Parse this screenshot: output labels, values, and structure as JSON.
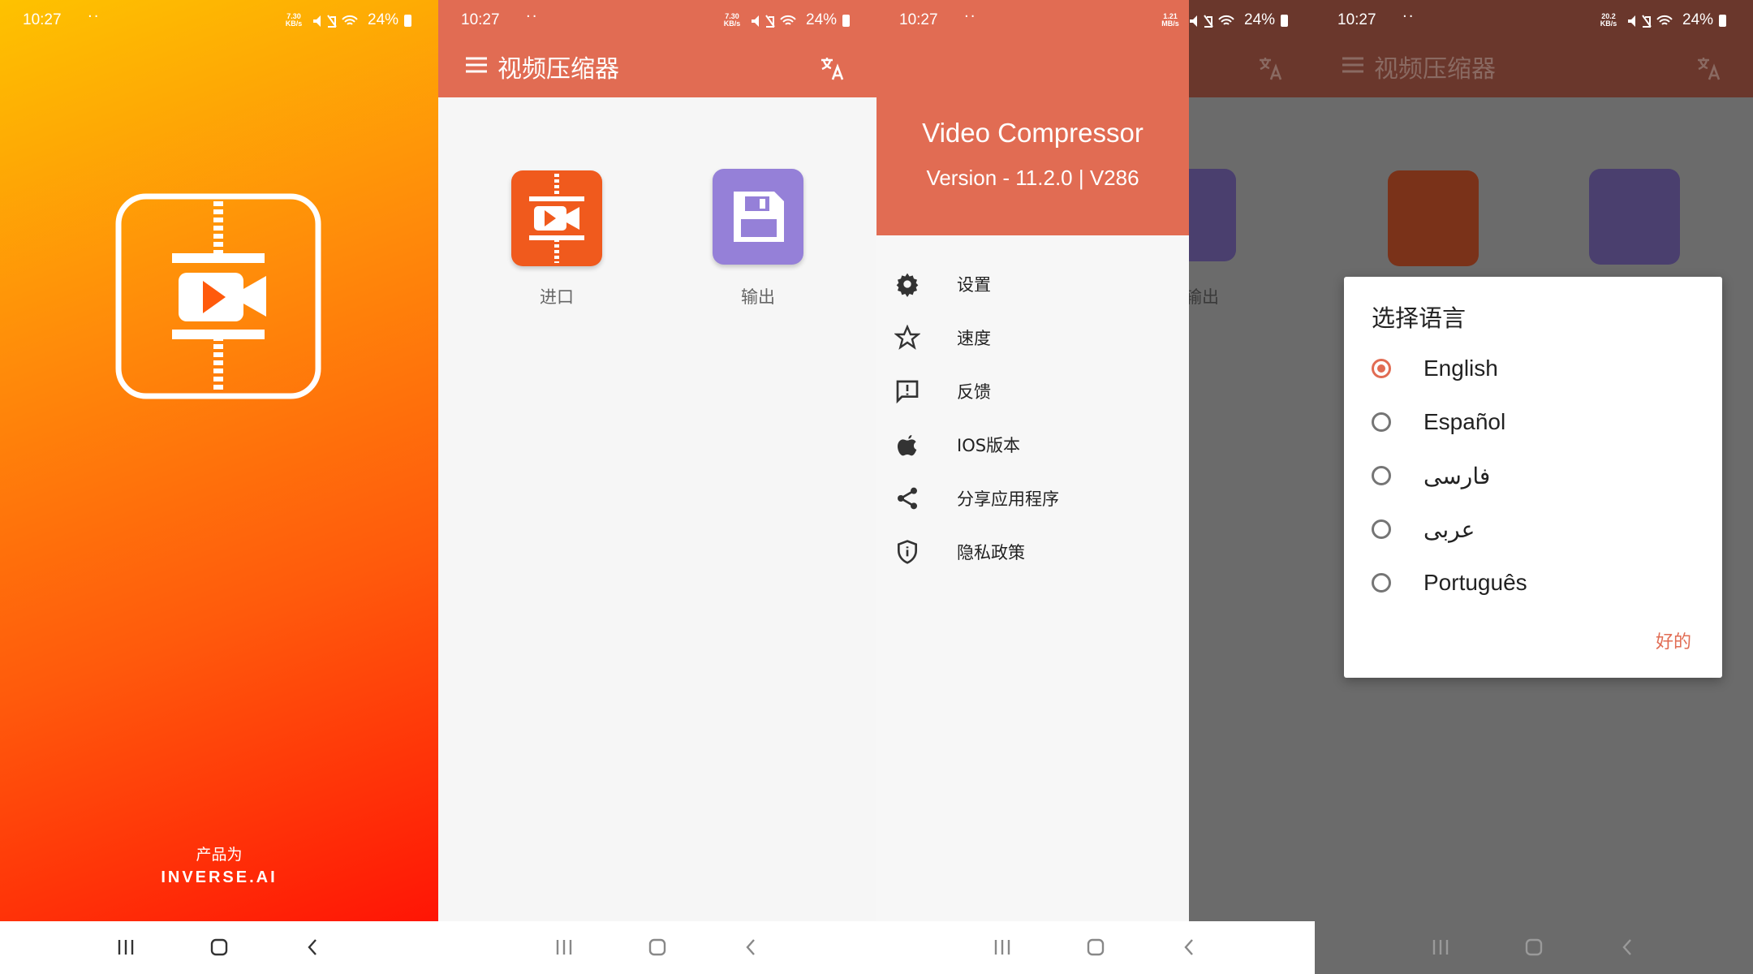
{
  "status_bars": [
    {
      "time": "10:27",
      "net_speed": "7.30\nKB/s",
      "battery": "24%"
    },
    {
      "time": "10:27",
      "net_speed": "7.30\nKB/s",
      "battery": "24%"
    },
    {
      "time": "10:27",
      "net_speed": "1.21\nMB/s",
      "battery": "24%"
    },
    {
      "time": "10:27",
      "net_speed": "20.2\nKB/s",
      "battery": "24%"
    }
  ],
  "splash": {
    "made_by": "产品为",
    "brand": "INVERSE.AI"
  },
  "home": {
    "title": "视频压缩器",
    "import_label": "进口",
    "output_label": "输出"
  },
  "drawer": {
    "app_name": "Video Compressor",
    "version": "Version - 11.2.0 | V286",
    "items": [
      {
        "label": "设置",
        "icon": "gear-icon"
      },
      {
        "label": "速度",
        "icon": "star-icon"
      },
      {
        "label": "反馈",
        "icon": "feedback-icon"
      },
      {
        "label": "IOS版本",
        "icon": "apple-icon"
      },
      {
        "label": "分享应用程序",
        "icon": "share-icon"
      },
      {
        "label": "隐私政策",
        "icon": "shield-icon"
      }
    ],
    "behind_label": "输出"
  },
  "language_dialog": {
    "title": "选择语言",
    "options": [
      "English",
      "Español",
      "فارسی",
      "عربی",
      "Português"
    ],
    "selected": "English",
    "ok": "好的"
  },
  "colors": {
    "accent": "#e16c53",
    "import_tile": "#f05a1d",
    "output_tile": "#9580d8"
  }
}
